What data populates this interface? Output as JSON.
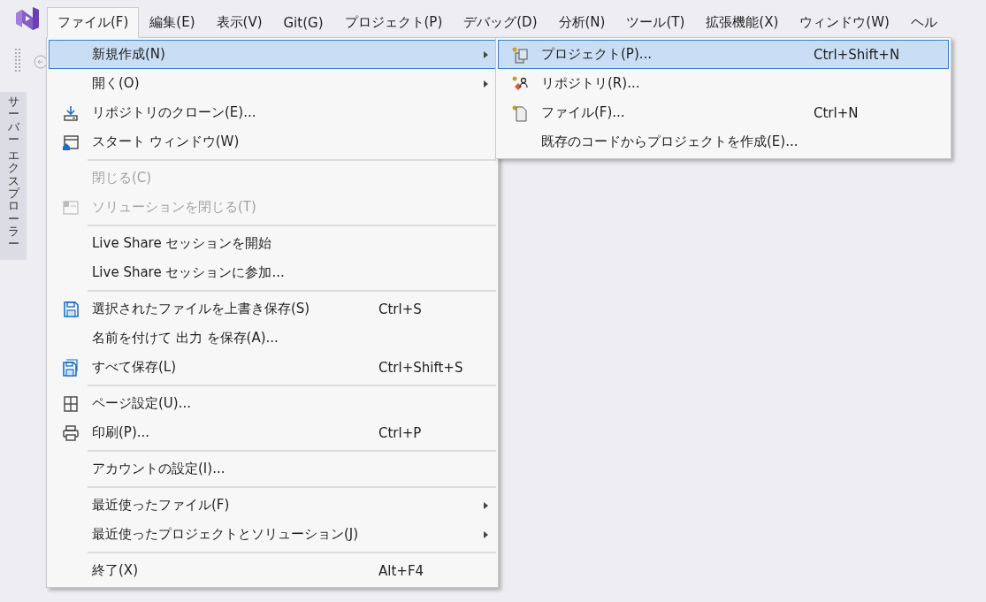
{
  "menu_bar": {
    "items": [
      {
        "label": "ファイル(F)",
        "selected": true
      },
      {
        "label": "編集(E)",
        "selected": false
      },
      {
        "label": "表示(V)",
        "selected": false
      },
      {
        "label": "Git(G)",
        "selected": false
      },
      {
        "label": "プロジェクト(P)",
        "selected": false
      },
      {
        "label": "デバッグ(D)",
        "selected": false
      },
      {
        "label": "分析(N)",
        "selected": false
      },
      {
        "label": "ツール(T)",
        "selected": false
      },
      {
        "label": "拡張機能(X)",
        "selected": false
      },
      {
        "label": "ウィンドウ(W)",
        "selected": false
      },
      {
        "label": "ヘル",
        "selected": false
      }
    ]
  },
  "side_panel": {
    "tab_words": [
      "サーバー",
      "エクスプローラー"
    ]
  },
  "file_menu": {
    "groups": [
      {
        "items": [
          {
            "label": "新規作成(N)",
            "selected": true,
            "disabled": false,
            "has_submenu": true
          },
          {
            "label": "開く(O)",
            "selected": false,
            "disabled": false,
            "has_submenu": true
          },
          {
            "label": "リポジトリのクローン(E)...",
            "selected": false,
            "disabled": false,
            "has_submenu": false
          },
          {
            "label": "スタート ウィンドウ(W)",
            "selected": false,
            "disabled": false,
            "has_submenu": false
          }
        ]
      },
      {
        "items": [
          {
            "label": "閉じる(C)",
            "selected": false,
            "disabled": true,
            "has_submenu": false
          },
          {
            "label": "ソリューションを閉じる(T)",
            "selected": false,
            "disabled": true,
            "has_submenu": false
          }
        ]
      },
      {
        "items": [
          {
            "label": "Live Share セッションを開始",
            "selected": false,
            "disabled": false,
            "has_submenu": false
          },
          {
            "label": "Live Share セッションに参加...",
            "selected": false,
            "disabled": false,
            "has_submenu": false
          }
        ]
      },
      {
        "items": [
          {
            "label": "選択されたファイルを上書き保存(S)",
            "shortcut": "Ctrl+S",
            "selected": false,
            "disabled": false,
            "has_submenu": false
          },
          {
            "label": "名前を付けて 出力 を保存(A)...",
            "selected": false,
            "disabled": false,
            "has_submenu": false
          },
          {
            "label": "すべて保存(L)",
            "shortcut": "Ctrl+Shift+S",
            "selected": false,
            "disabled": false,
            "has_submenu": false
          }
        ]
      },
      {
        "items": [
          {
            "label": "ページ設定(U)...",
            "selected": false,
            "disabled": false,
            "has_submenu": false
          },
          {
            "label": "印刷(P)...",
            "shortcut": "Ctrl+P",
            "selected": false,
            "disabled": false,
            "has_submenu": false
          }
        ]
      },
      {
        "items": [
          {
            "label": "アカウントの設定(I)...",
            "selected": false,
            "disabled": false,
            "has_submenu": false
          }
        ]
      },
      {
        "items": [
          {
            "label": "最近使ったファイル(F)",
            "selected": false,
            "disabled": false,
            "has_submenu": true
          },
          {
            "label": "最近使ったプロジェクトとソリューション(J)",
            "selected": false,
            "disabled": false,
            "has_submenu": true
          }
        ]
      },
      {
        "items": [
          {
            "label": "終了(X)",
            "shortcut": "Alt+F4",
            "selected": false,
            "disabled": false,
            "has_submenu": false
          }
        ]
      }
    ]
  },
  "new_submenu": {
    "groups": [
      {
        "items": [
          {
            "label": "プロジェクト(P)...",
            "shortcut": "Ctrl+Shift+N",
            "selected": true,
            "disabled": false,
            "has_submenu": false
          },
          {
            "label": "リポジトリ(R)...",
            "selected": false,
            "disabled": false,
            "has_submenu": false
          },
          {
            "label": "ファイル(F)...",
            "shortcut": "Ctrl+N",
            "selected": false,
            "disabled": false,
            "has_submenu": false
          },
          {
            "label": "既存のコードからプロジェクトを作成(E)...",
            "selected": false,
            "disabled": false,
            "has_submenu": false
          }
        ]
      }
    ]
  }
}
